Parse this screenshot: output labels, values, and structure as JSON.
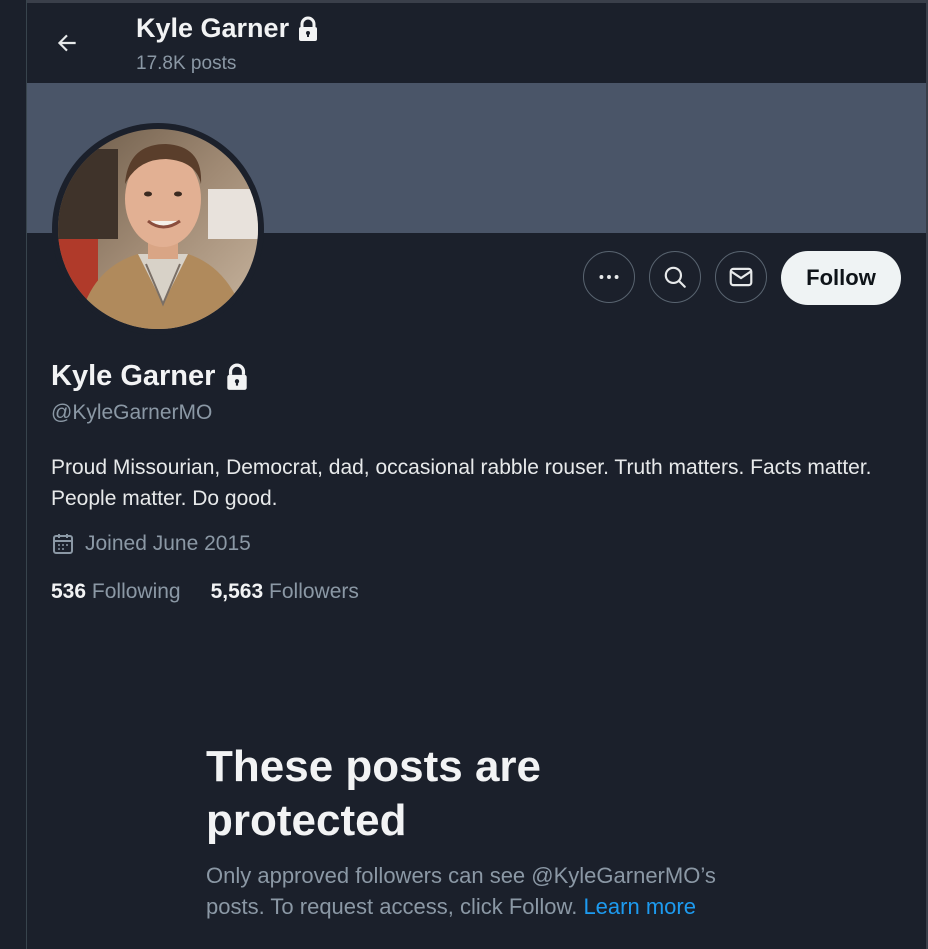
{
  "header": {
    "title": "Kyle Garner",
    "posts_count": "17.8K posts"
  },
  "profile": {
    "name": "Kyle Garner",
    "handle": "@KyleGarnerMO",
    "bio": "Proud Missourian, Democrat, dad, occasional rabble rouser. Truth matters. Facts matter. People matter. Do good.",
    "joined": "Joined June 2015",
    "following_count": "536",
    "following_label": "Following",
    "followers_count": "5,563",
    "followers_label": "Followers"
  },
  "actions": {
    "more_icon": "more-dots-icon",
    "search_icon": "search-icon",
    "message_icon": "envelope-icon",
    "follow_label": "Follow"
  },
  "protected": {
    "title": "These posts are protected",
    "text": "Only approved followers can see @KyleGarnerMO’s posts. To request access, click Follow.",
    "link": "Learn more"
  },
  "colors": {
    "background": "#1b202b",
    "banner": "#4a5568",
    "link": "#1d9bf0",
    "muted": "#8b98a5"
  }
}
